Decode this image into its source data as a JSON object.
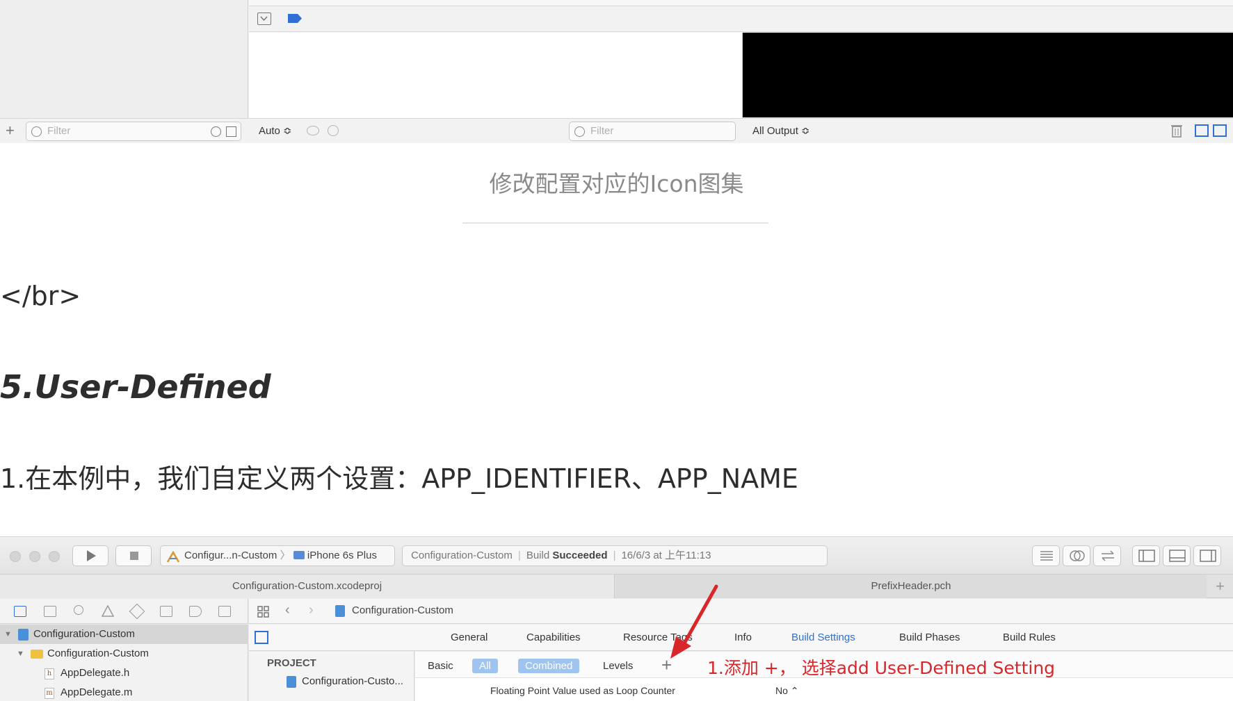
{
  "top_screenshot": {
    "filter_placeholder_left": "Filter",
    "auto_label": "Auto ≎",
    "filter_placeholder_center": "Filter",
    "output_label": "All Output ≎"
  },
  "article": {
    "caption": "修改配置对应的Icon图集",
    "br_text": "</br>",
    "section_heading": "5.User-Defined",
    "paragraph": "1.在本例中，我们自定义两个设置：APP_IDENTIFIER、APP_NAME"
  },
  "bottom_screenshot": {
    "scheme_target": "Configur...n-Custom",
    "scheme_device": "iPhone 6s Plus",
    "status_project": "Configuration-Custom",
    "status_build_prefix": "Build",
    "status_build_result": "Succeeded",
    "status_time": "16/6/3 at 上午11:13",
    "file_tabs": [
      "Configuration-Custom.xcodeproj",
      "PrefixHeader.pch"
    ],
    "jump_bar_item": "Configuration-Custom",
    "navigator": [
      {
        "label": "Configuration-Custom",
        "kind": "project"
      },
      {
        "label": "Configuration-Custom",
        "kind": "folder"
      },
      {
        "label": "AppDelegate.h",
        "kind": "file",
        "letter": "h"
      },
      {
        "label": "AppDelegate.m",
        "kind": "file",
        "letter": "m"
      }
    ],
    "editor_tabs": [
      "General",
      "Capabilities",
      "Resource Tags",
      "Info",
      "Build Settings",
      "Build Phases",
      "Build Rules"
    ],
    "active_editor_tab": "Build Settings",
    "project_header": "PROJECT",
    "project_item": "Configuration-Custo...",
    "filter_segments": [
      "Basic",
      "All",
      "Combined",
      "Levels"
    ],
    "plus_symbol": "+",
    "annotation": "1.添加 +， 选择add User-Defined Setting",
    "partial_setting_name": "Floating Point Value used as Loop Counter",
    "partial_setting_value": "No ⌃"
  },
  "colors": {
    "accent_blue": "#2f6fd6",
    "annotation_red": "#d9262a",
    "segment_highlight": "#9ec4ef"
  }
}
